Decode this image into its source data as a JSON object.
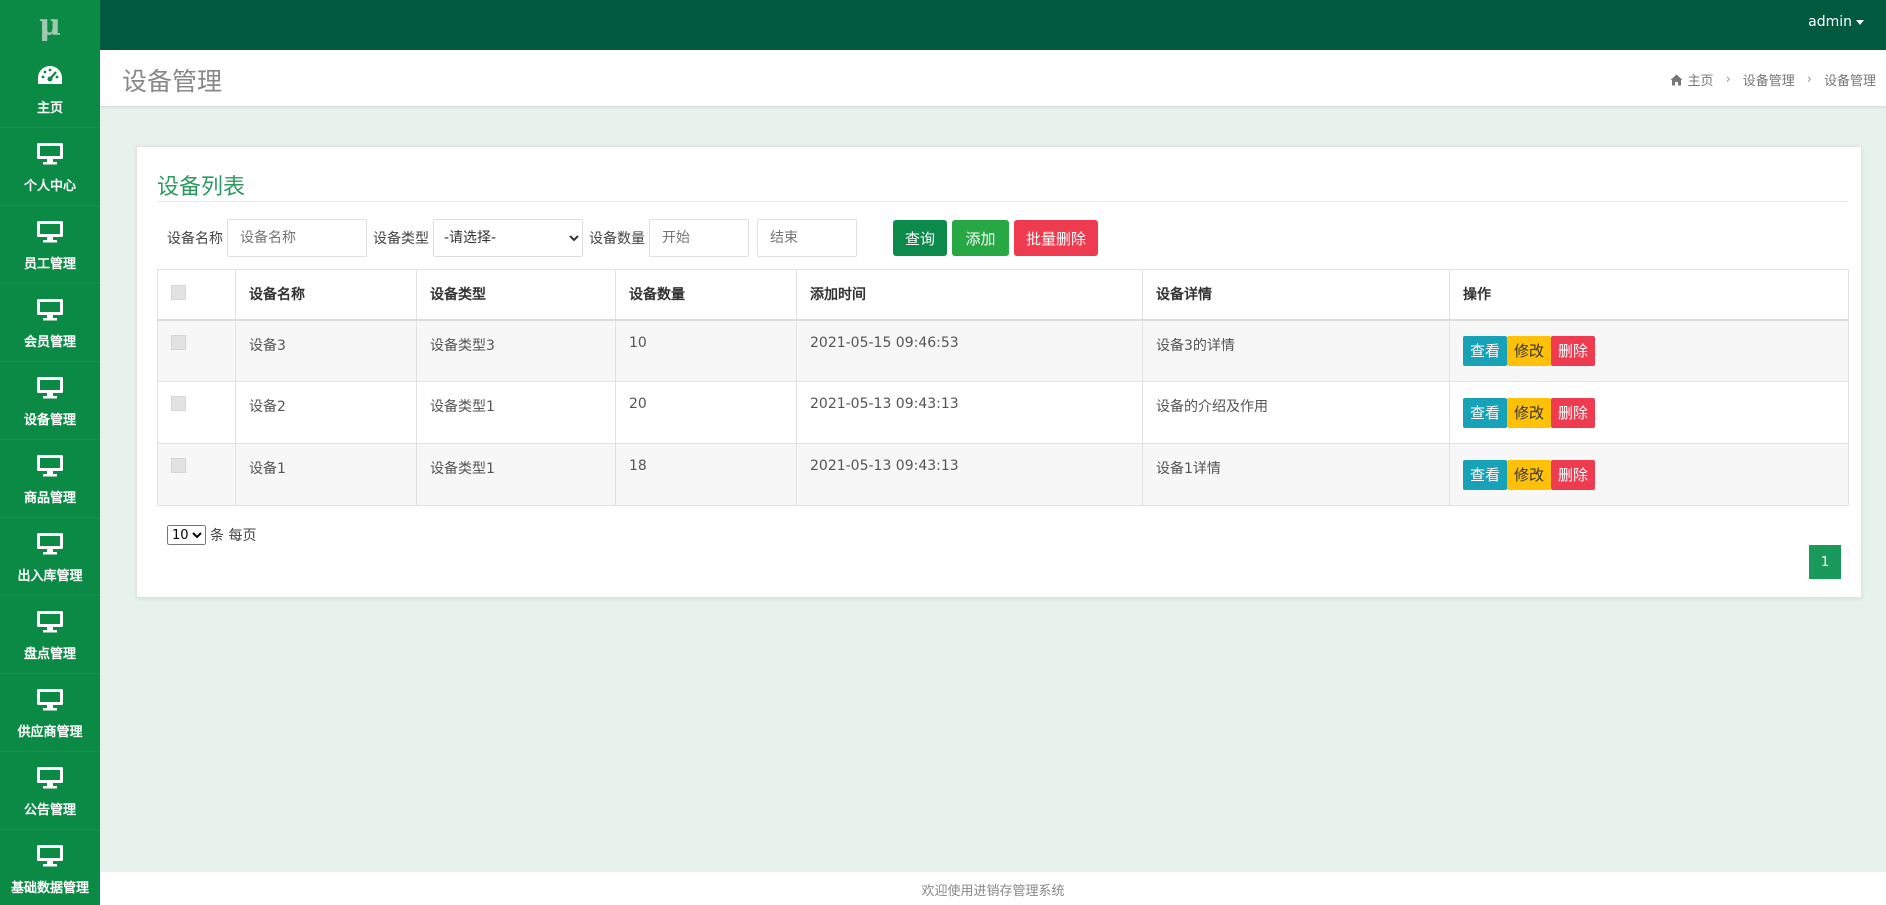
{
  "app": {
    "logo": "μ"
  },
  "topbar": {
    "user": "admin"
  },
  "sidebar": {
    "items": [
      {
        "label": "主页",
        "icon": "dashboard-icon"
      },
      {
        "label": "个人中心",
        "icon": "monitor-icon"
      },
      {
        "label": "员工管理",
        "icon": "monitor-icon"
      },
      {
        "label": "会员管理",
        "icon": "monitor-icon"
      },
      {
        "label": "设备管理",
        "icon": "monitor-icon"
      },
      {
        "label": "商品管理",
        "icon": "monitor-icon"
      },
      {
        "label": "出入库管理",
        "icon": "monitor-icon"
      },
      {
        "label": "盘点管理",
        "icon": "monitor-icon"
      },
      {
        "label": "供应商管理",
        "icon": "monitor-icon"
      },
      {
        "label": "公告管理",
        "icon": "monitor-icon"
      },
      {
        "label": "基础数据管理",
        "icon": "monitor-icon"
      }
    ]
  },
  "header": {
    "title": "设备管理",
    "breadcrumb": [
      "主页",
      "设备管理",
      "设备管理"
    ]
  },
  "card": {
    "title": "设备列表",
    "filters": {
      "name_label": "设备名称",
      "name_placeholder": "设备名称",
      "type_label": "设备类型",
      "type_selected": "-请选择-",
      "qty_label": "设备数量",
      "qty_start_placeholder": "开始",
      "qty_end_placeholder": "结束"
    },
    "buttons": {
      "query": "查询",
      "add": "添加",
      "bulk_delete": "批量删除"
    }
  },
  "table": {
    "columns": [
      "设备名称",
      "设备类型",
      "设备数量",
      "添加时间",
      "设备详情",
      "操作"
    ],
    "rows": [
      {
        "name": "设备3",
        "type": "设备类型3",
        "qty": "10",
        "time": "2021-05-15 09:46:53",
        "detail": "设备3的详情"
      },
      {
        "name": "设备2",
        "type": "设备类型1",
        "qty": "20",
        "time": "2021-05-13 09:43:13",
        "detail": "设备的介绍及作用"
      },
      {
        "name": "设备1",
        "type": "设备类型1",
        "qty": "18",
        "time": "2021-05-13 09:43:13",
        "detail": "设备1详情"
      }
    ],
    "actions": {
      "view": "查看",
      "edit": "修改",
      "delete": "删除"
    }
  },
  "pagination": {
    "page_size": "10",
    "page_size_suffix": "条 每页",
    "current_page": "1"
  },
  "footer": {
    "text": "欢迎使用进销存管理系统"
  },
  "colors": {
    "sidebar": "#0b8a45",
    "topbar": "#015a3d",
    "accent": "#2d9b5f",
    "danger": "#ef3b4f",
    "warning": "#ffc107",
    "info": "#17a2b8"
  }
}
